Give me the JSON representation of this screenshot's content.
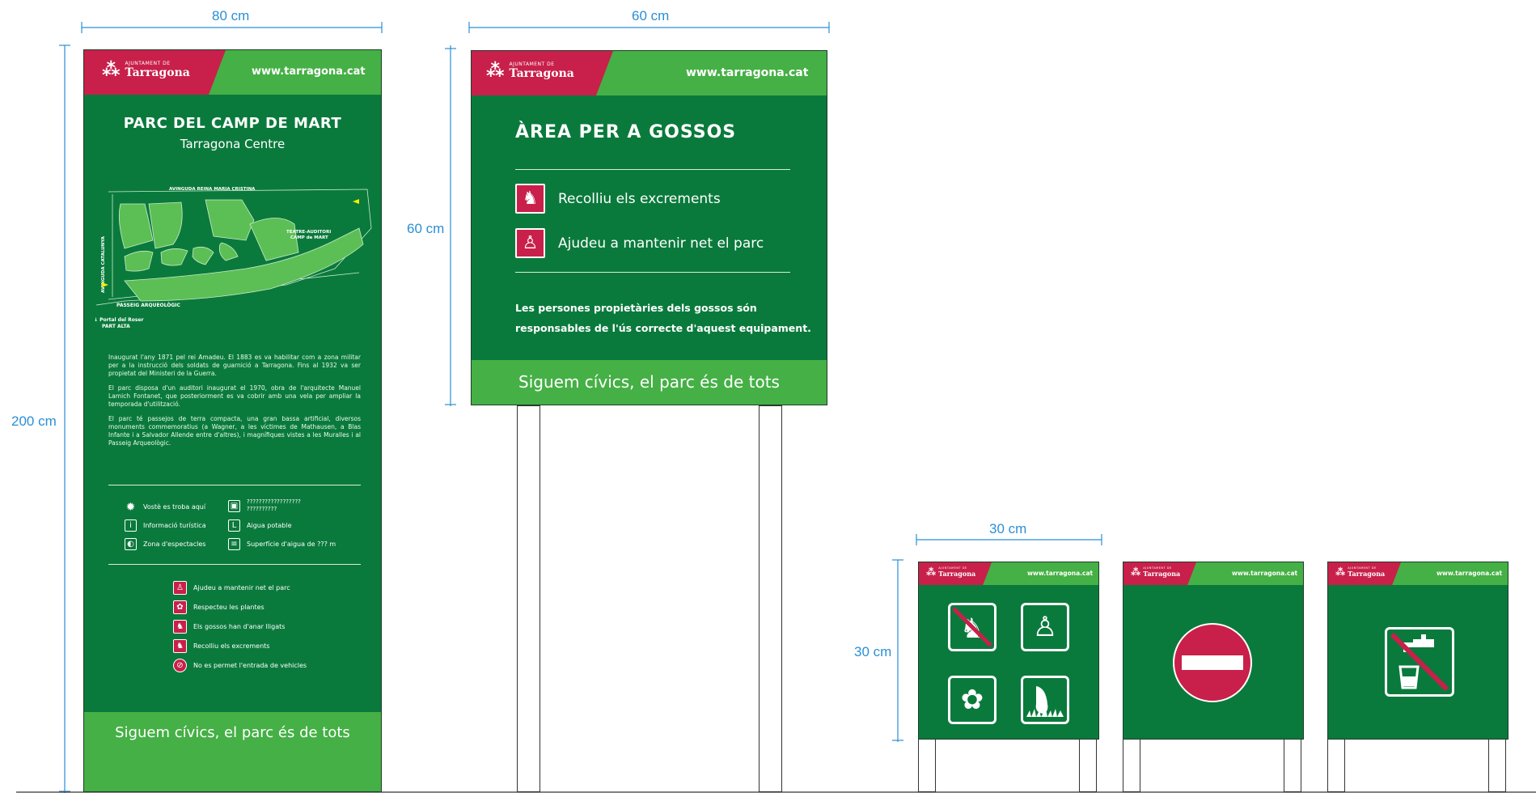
{
  "dimensions": {
    "tall_width": "80 cm",
    "tall_height": "200 cm",
    "medium_width": "60 cm",
    "medium_height": "60 cm",
    "small_width": "30 cm",
    "small_height": "30 cm"
  },
  "brand": {
    "logo_small_text": "AJUNTAMENT DE",
    "logo_name": "Tarragona",
    "url": "www.tarragona.cat",
    "colors": {
      "dark_green": "#0a7a3c",
      "light_green": "#45b045",
      "red": "#c8204a",
      "dimension_blue": "#2a8fd6"
    }
  },
  "tall_sign": {
    "title": "PARC DEL CAMP DE MART",
    "subtitle": "Tarragona Centre",
    "map_labels": {
      "avinguda_reina": "AVINGUDA REINA MARIA CRISTINA",
      "avinguda_catalunya": "AVINGUDA CATALUNYA",
      "teatre": "TEATRE-AUDITORI",
      "camp_de_mart": "CAMP de MART",
      "passeig": "PASSEIG ARQUEOLÒGIC",
      "portal": "Portal del Roser",
      "part_alta": "PART ALTA"
    },
    "paragraphs": [
      "Inaugurat l'any 1871 pel rei Amadeu. El 1883 es va habilitar com a zona militar per a la instrucció dels soldats de guarnició a Tarragona. Fins al 1932 va ser propietat del Ministeri de la Guerra.",
      "El parc disposa d'un auditori inaugurat el 1970, obra de l'arquitecte Manuel Lamich Fontanet, que posteriorment es va cobrir amb una vela per ampliar la temporada d'utilització.",
      "El parc té passejos de terra compacta, una gran bassa artificial, diversos monuments commemoratius (a Wagner, a les víctimes de Mathausen, a Blas Infante i a Salvador Allende entre d'altres), i magnífiques vistes a les Muralles i al Passeig Arqueològic."
    ],
    "legend_left": [
      {
        "icon": "sun-icon",
        "glyph": "✹",
        "label": "Vostè es troba aquí"
      },
      {
        "icon": "info-icon",
        "glyph": "i",
        "label": "Informació turística"
      },
      {
        "icon": "stage-icon",
        "glyph": "◐",
        "label": "Zona d'espectacles"
      }
    ],
    "legend_right": [
      {
        "icon": "toilet-icon",
        "glyph": "▣",
        "label": "??????????????????\n??????????"
      },
      {
        "icon": "water-tap-icon",
        "glyph": "L",
        "label": "Aigua potable"
      },
      {
        "icon": "water-surface-icon",
        "glyph": "≡",
        "label": "Superfície d'aigua de ??? m"
      }
    ],
    "rules": [
      {
        "icon": "trash-person-icon",
        "glyph": "♙",
        "label": "Ajudeu a mantenir net el parc"
      },
      {
        "icon": "plant-icon",
        "glyph": "✿",
        "label": "Respecteu les plantes"
      },
      {
        "icon": "dog-leash-icon",
        "glyph": "♞",
        "label": "Els gossos han d'anar lligats"
      },
      {
        "icon": "dog-waste-icon",
        "glyph": "♞",
        "label": "Recolliu els excrements"
      },
      {
        "icon": "no-vehicles-icon",
        "glyph": "⊘",
        "label": "No es permet l'entrada de vehicles"
      }
    ],
    "footer": "Siguem cívics, el parc és de tots"
  },
  "medium_sign": {
    "title": "ÀREA PER A GOSSOS",
    "items": [
      {
        "icon": "dog-waste-icon",
        "glyph": "♞",
        "label": "Recolliu els excrements"
      },
      {
        "icon": "trash-person-icon",
        "glyph": "♙",
        "label": "Ajudeu a mantenir net el parc"
      }
    ],
    "note_line1": "Les persones propietàries dels gossos són",
    "note_line2": "responsables de l'ús correcte d'aquest equipament.",
    "footer": "Siguem cívics, el parc és de tots"
  },
  "small_signs": [
    {
      "icons": [
        "no-dogs-icon",
        "trash-person-icon",
        "flower-icon",
        "grass-foot-icon"
      ]
    },
    {
      "icons": [
        "no-entry-icon"
      ]
    },
    {
      "icons": [
        "no-drinking-water-icon"
      ]
    }
  ]
}
